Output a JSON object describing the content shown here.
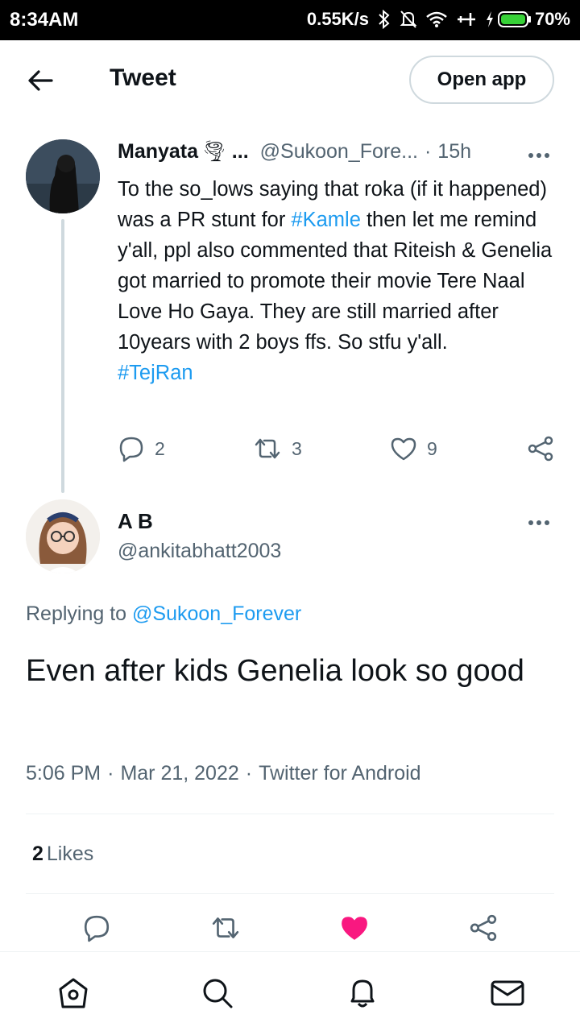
{
  "status_bar": {
    "time": "8:34AM",
    "network_speed": "0.55K/s",
    "battery": "70%"
  },
  "header": {
    "title": "Tweet",
    "open_app_label": "Open app"
  },
  "parent_tweet": {
    "name": "Manyata",
    "name_emoji": "🌪",
    "name_ellipsis": "...",
    "handle": "@Sukoon_Fore...",
    "separator": "·",
    "time": "15h",
    "text_1": "To the so_lows saying that roka (if it happened) was a PR stunt for ",
    "hashtag_1": "#Kamle",
    "text_2": " then let me remind y'all, ppl also commented that Riteish & Genelia got married to promote their movie Tere Naal Love Ho Gaya. They are still married after 10years with 2 boys ffs. So stfu y'all.",
    "hashtag_2": "#TejRan",
    "replies": "2",
    "retweets": "3",
    "likes": "9"
  },
  "reply_tweet": {
    "name": "A B",
    "handle": "@ankitabhatt2003",
    "replying_prefix": "Replying to",
    "replying_handle": "@Sukoon_Forever",
    "text": "Even after kids Genelia look so good",
    "time": "5:06 PM",
    "date": "Mar 21, 2022",
    "source": "Twitter for Android",
    "sep": "·",
    "likes_count": "2",
    "likes_label": "Likes"
  },
  "colors": {
    "accent": "#1d9bf0",
    "like": "#f91880",
    "secondary": "#536471",
    "text": "#0f1419"
  }
}
